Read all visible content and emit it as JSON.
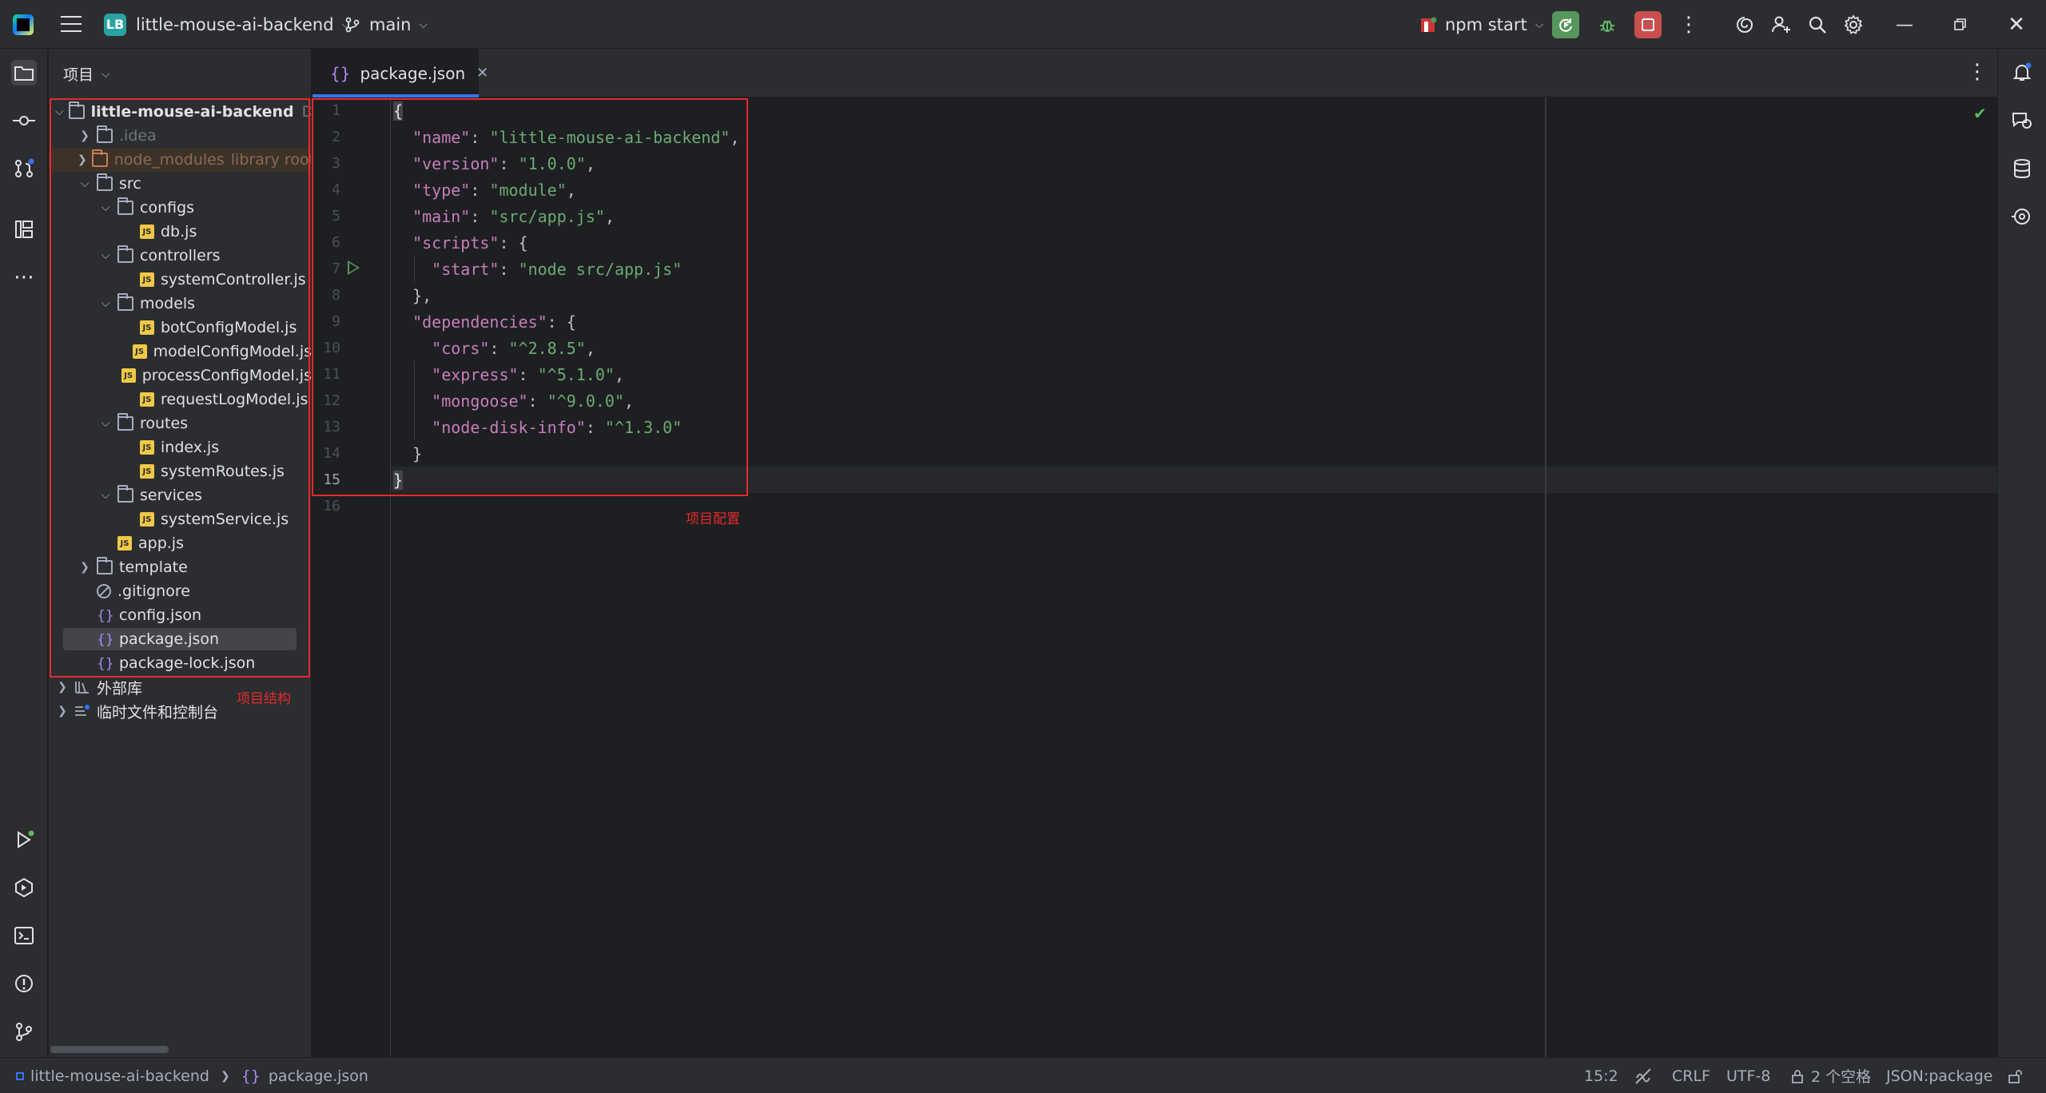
{
  "titlebar": {
    "project_badge": "LB",
    "project_name": "little-mouse-ai-backend",
    "branch": "main",
    "run_config": "npm start"
  },
  "project_panel": {
    "header": "项目",
    "root_name": "little-mouse-ai-backend",
    "root_path_hint": "D:\\P",
    "items": [
      {
        "label": ".idea"
      },
      {
        "label": "node_modules",
        "hint": "library root"
      },
      {
        "label": "src"
      },
      {
        "label": "configs"
      },
      {
        "label": "db.js"
      },
      {
        "label": "controllers"
      },
      {
        "label": "systemController.js"
      },
      {
        "label": "models"
      },
      {
        "label": "botConfigModel.js"
      },
      {
        "label": "modelConfigModel.js"
      },
      {
        "label": "processConfigModel.js"
      },
      {
        "label": "requestLogModel.js"
      },
      {
        "label": "routes"
      },
      {
        "label": "index.js"
      },
      {
        "label": "systemRoutes.js"
      },
      {
        "label": "services"
      },
      {
        "label": "systemService.js"
      },
      {
        "label": "app.js"
      },
      {
        "label": "template"
      },
      {
        "label": ".gitignore"
      },
      {
        "label": "config.json"
      },
      {
        "label": "package.json"
      },
      {
        "label": "package-lock.json"
      },
      {
        "label": "外部库"
      },
      {
        "label": "临时文件和控制台"
      }
    ]
  },
  "editor": {
    "tab_label": "package.json",
    "line_numbers": [
      "1",
      "2",
      "3",
      "4",
      "5",
      "6",
      "7",
      "8",
      "9",
      "10",
      "11",
      "12",
      "13",
      "14",
      "15",
      "16"
    ],
    "code": {
      "l1": "{",
      "name_key": "\"name\"",
      "name_val": "\"little-mouse-ai-backend\"",
      "version_key": "\"version\"",
      "version_val": "\"1.0.0\"",
      "type_key": "\"type\"",
      "type_val": "\"module\"",
      "main_key": "\"main\"",
      "main_val": "\"src/app.js\"",
      "scripts_key": "\"scripts\"",
      "start_key": "\"start\"",
      "start_val": "\"node src/app.js\"",
      "deps_key": "\"dependencies\"",
      "cors_key": "\"cors\"",
      "cors_val": "\"^2.8.5\"",
      "express_key": "\"express\"",
      "express_val": "\"^5.1.0\"",
      "mongoose_key": "\"mongoose\"",
      "mongoose_val": "\"^9.0.0\"",
      "ndi_key": "\"node-disk-info\"",
      "ndi_val": "\"^1.3.0\"",
      "l15": "}"
    }
  },
  "annotations": {
    "structure_label": "项目结构",
    "config_label": "项目配置"
  },
  "statusbar": {
    "breadcrumb_project": "little-mouse-ai-backend",
    "breadcrumb_file": "package.json",
    "position": "15:2",
    "line_ending": "CRLF",
    "encoding": "UTF-8",
    "indent": "2 个空格",
    "file_type": "JSON:package"
  },
  "colors": {
    "annotation": "#e52a2a",
    "accent": "#3574f0",
    "keyword": "#c77dbb",
    "string": "#6aab73"
  }
}
